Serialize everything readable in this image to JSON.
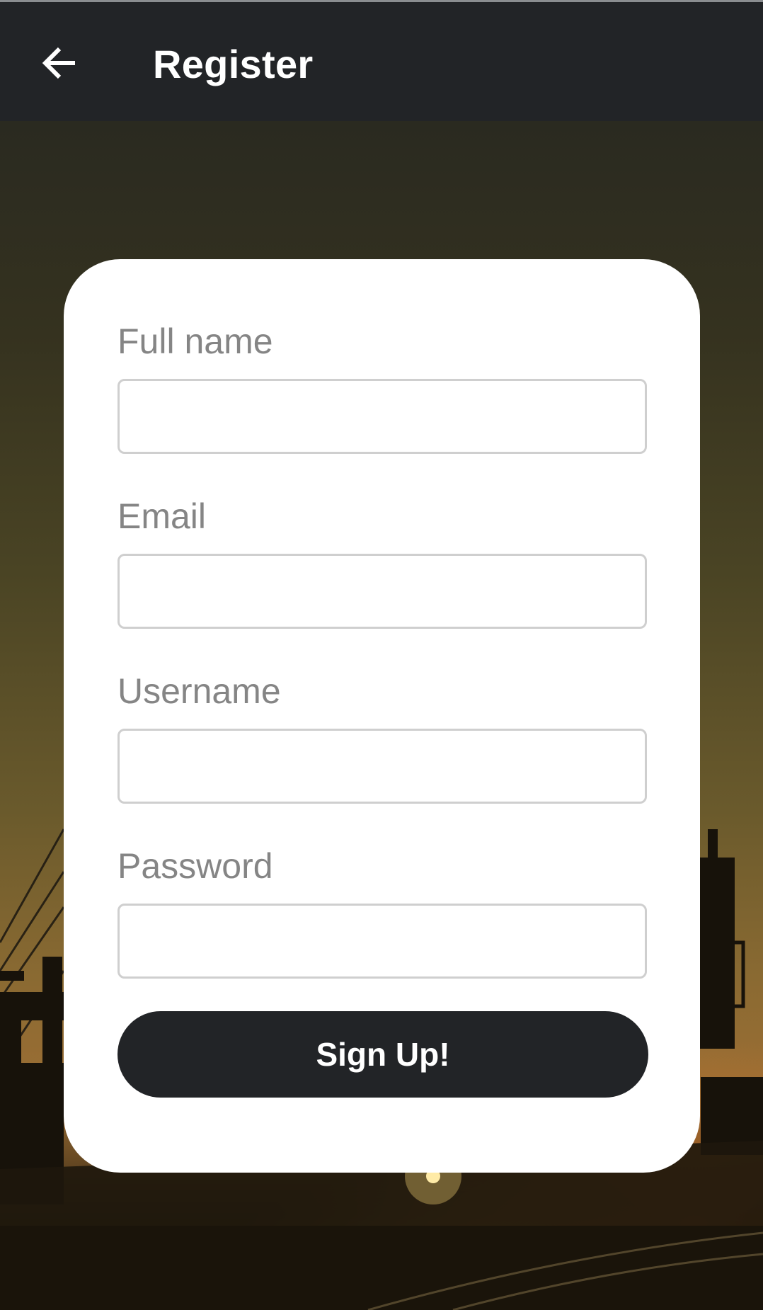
{
  "app_bar": {
    "title": "Register",
    "back_icon": "arrow-left-icon"
  },
  "form": {
    "fields": [
      {
        "label": "Full name",
        "value": "",
        "placeholder": ""
      },
      {
        "label": "Email",
        "value": "",
        "placeholder": ""
      },
      {
        "label": "Username",
        "value": "",
        "placeholder": ""
      },
      {
        "label": "Password",
        "value": "",
        "placeholder": ""
      }
    ],
    "submit_label": "Sign Up!"
  },
  "colors": {
    "app_bar": "#222427",
    "button": "#222427",
    "label": "#858585",
    "input_border": "#cfcfcf",
    "card": "#ffffff"
  }
}
